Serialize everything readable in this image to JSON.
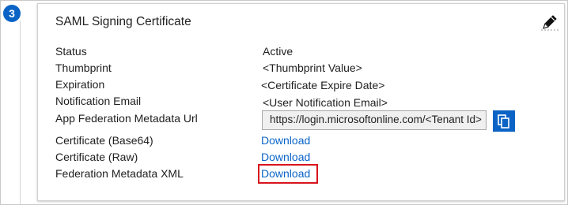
{
  "step": {
    "number": "3"
  },
  "card": {
    "title": "SAML Signing Certificate",
    "rows": [
      {
        "label": "Status",
        "value": "Active"
      },
      {
        "label": "Thumbprint",
        "value": "<Thumbprint Value>"
      },
      {
        "label": "Expiration",
        "value": "<Certificate Expire Date>"
      },
      {
        "label": "Notification Email",
        "value": "<User Notification Email>"
      },
      {
        "label": "App Federation Metadata Url",
        "value": "https://login.microsoftonline.com/<Tenant Id>"
      },
      {
        "label": "Certificate (Base64)",
        "value": "Download"
      },
      {
        "label": "Certificate (Raw)",
        "value": "Download"
      },
      {
        "label": "Federation Metadata XML",
        "value": "Download"
      }
    ]
  },
  "icons": {
    "edit": "pencil-edit-icon",
    "copy": "copy-icon"
  },
  "colors": {
    "accent": "#0b63c5",
    "link": "#0a64c8",
    "highlight": "#d8141c"
  }
}
